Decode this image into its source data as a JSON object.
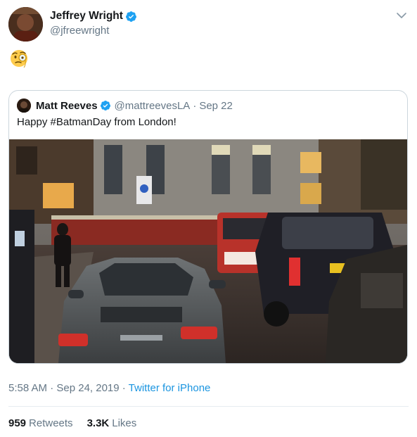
{
  "author": {
    "display_name": "Jeffrey Wright",
    "handle": "@jfreewright",
    "verified": true
  },
  "tweet": {
    "emoji": "face-with-monocle",
    "menu_icon": "chevron-down-icon"
  },
  "quoted_tweet": {
    "display_name": "Matt Reeves",
    "handle": "@mattreevesLA",
    "separator": "·",
    "date": "Sep 22",
    "text": "Happy #BatmanDay from London!",
    "verified": true,
    "media": "night-street-photo-with-porsche-and-london-taxi"
  },
  "meta": {
    "timestamp": "5:58 AM · Sep 24, 2019 · ",
    "source": "Twitter for iPhone"
  },
  "stats": {
    "retweets_count": "959",
    "retweets_label": "Retweets",
    "likes_count": "3.3K",
    "likes_label": "Likes"
  },
  "colors": {
    "link": "#1b95e0",
    "secondary_text": "#657786",
    "verified": "#1da1f2",
    "border": "#ccd6dd"
  }
}
